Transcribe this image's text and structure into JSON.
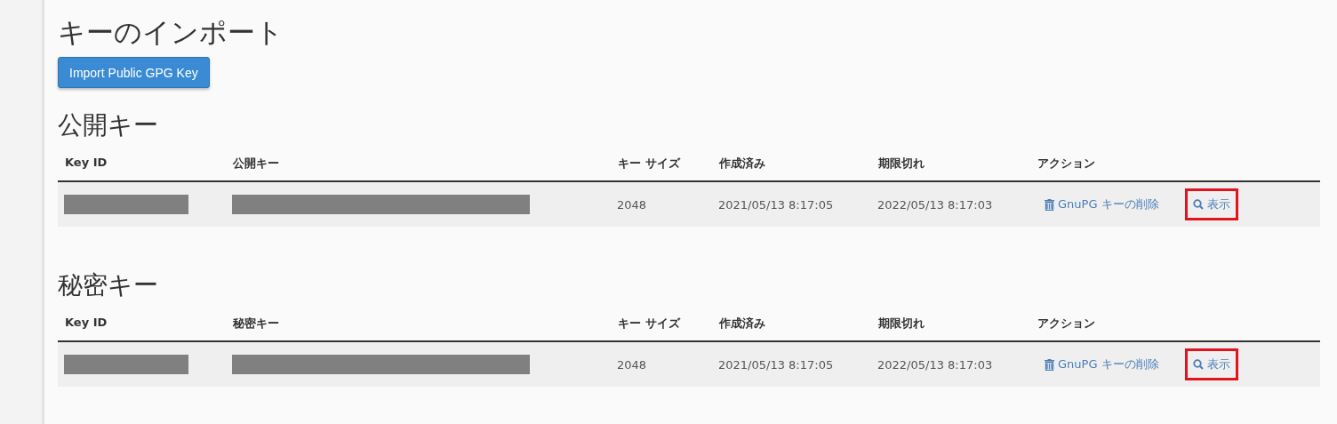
{
  "import_section": {
    "title": "キーのインポート",
    "button": "Import Public GPG Key"
  },
  "sections": [
    {
      "title": "公開キー",
      "columns": [
        "Key ID",
        "公開キー",
        "キー サイズ",
        "作成済み",
        "期限切れ",
        "アクション"
      ],
      "rows": [
        {
          "key_id": {
            "redacted": true
          },
          "key": {
            "redacted": true
          },
          "size": "2048",
          "created": "2021/05/13 8:17:05",
          "expires": "2022/05/13 8:17:03",
          "delete_action": "GnuPG キーの削除",
          "view_action": {
            "label": "表示",
            "highlighted": true
          }
        }
      ]
    },
    {
      "title": "秘密キー",
      "columns": [
        "Key ID",
        "秘密キー",
        "キー サイズ",
        "作成済み",
        "期限切れ",
        "アクション"
      ],
      "rows": [
        {
          "key_id": {
            "redacted": true
          },
          "key": {
            "redacted": true
          },
          "size": "2048",
          "created": "2021/05/13 8:17:05",
          "expires": "2022/05/13 8:17:03",
          "delete_action": "GnuPG キーの削除",
          "view_action": {
            "label": "表示",
            "highlighted": true
          }
        }
      ]
    }
  ]
}
